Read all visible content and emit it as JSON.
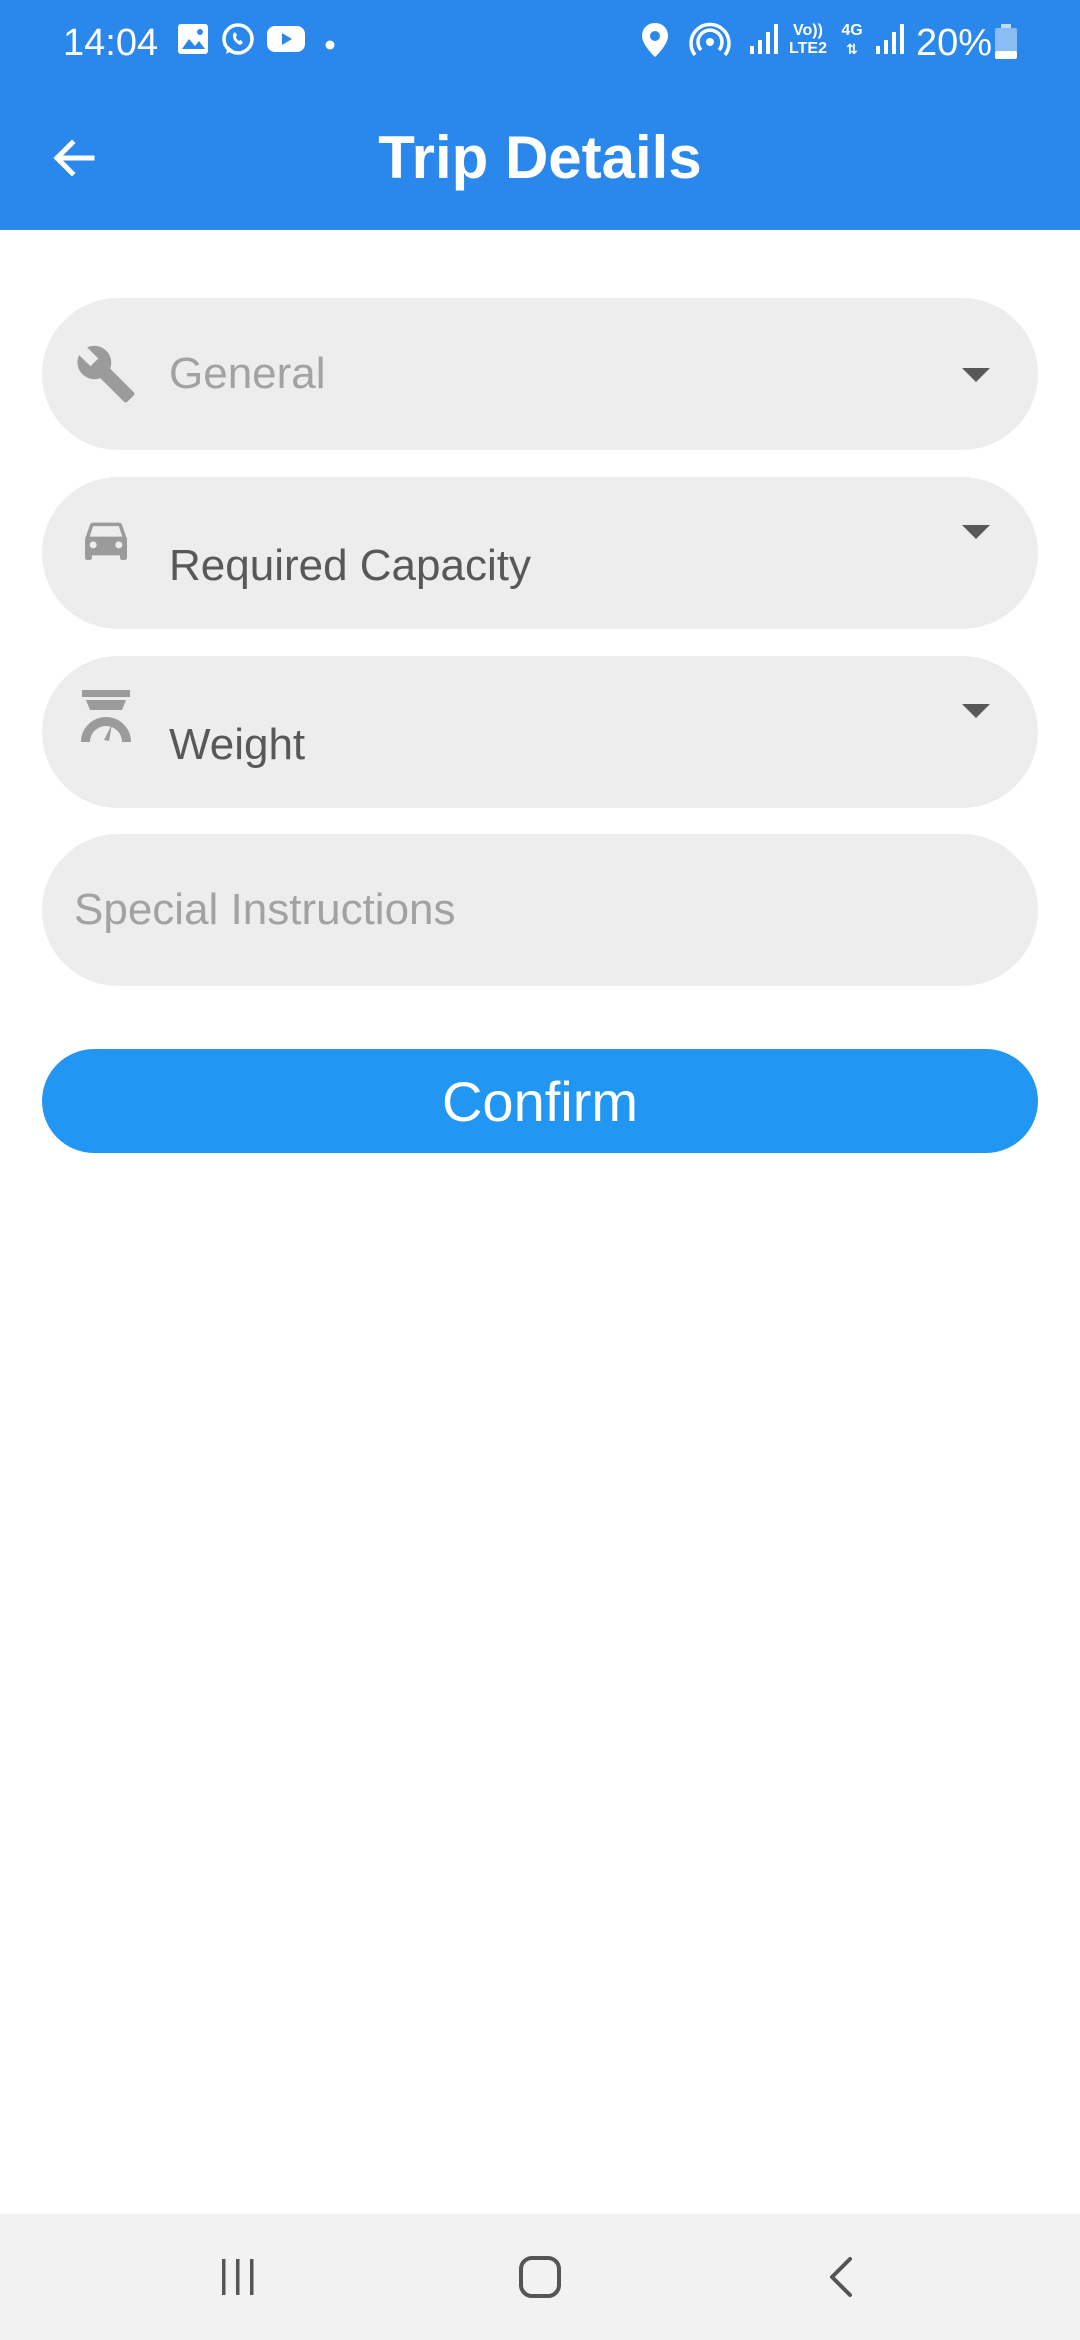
{
  "status_bar": {
    "time": "14:04",
    "battery": "20%",
    "left_icons": [
      "gallery-icon",
      "whatsapp-icon",
      "youtube-icon",
      "dot-icon"
    ],
    "right_icons": [
      "location-icon",
      "hotspot-icon",
      "signal-icon",
      "volte-icon",
      "4g-icon",
      "signal-icon",
      "battery-icon"
    ],
    "volte_label": "Vo))",
    "lte_label": "LTE2",
    "network_label": "4G"
  },
  "app_bar": {
    "title": "Trip Details",
    "back_icon": "arrow-left-icon"
  },
  "form": {
    "category": {
      "icon": "wrench-icon",
      "label": "General"
    },
    "capacity": {
      "icon": "car-icon",
      "label": "Required Capacity"
    },
    "weight": {
      "icon": "scale-icon",
      "label": "Weight"
    },
    "instructions": {
      "placeholder": "Special Instructions",
      "value": ""
    }
  },
  "confirm_label": "Confirm",
  "nav_bar": {
    "buttons": [
      "recent-apps-icon",
      "home-icon",
      "back-icon"
    ]
  },
  "colors": {
    "primary": "#2a87ec",
    "button": "#2196f3",
    "field_bg": "#ededed",
    "hint_text": "#a2a2a2",
    "value_text": "#585858"
  }
}
